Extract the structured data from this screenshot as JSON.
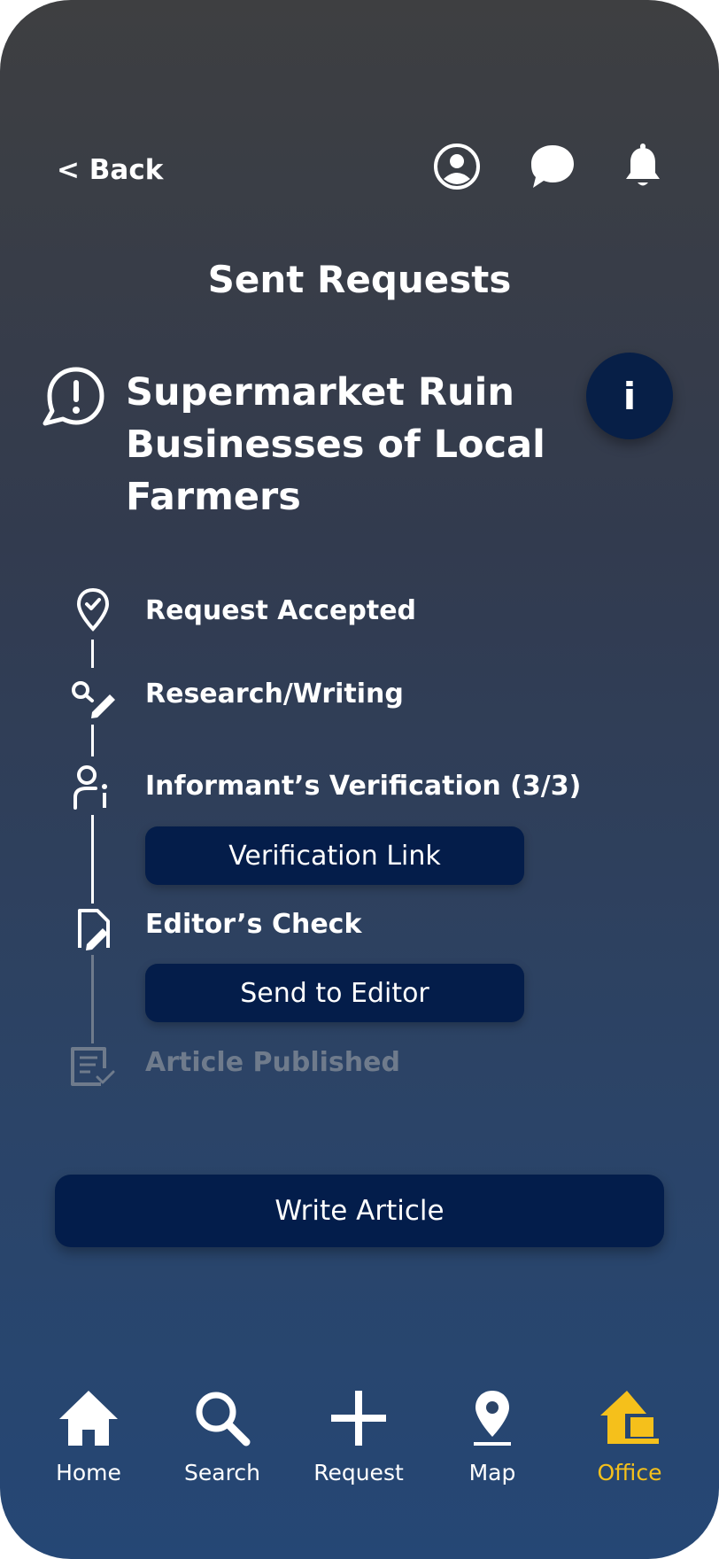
{
  "header": {
    "back_label": "< Back",
    "icons": [
      "profile-icon",
      "chat-icon",
      "bell-icon"
    ]
  },
  "page_title": "Sent Requests",
  "request": {
    "title": "Supermarket Ruin Businesses of Local Farmers",
    "info_label": "i"
  },
  "timeline": {
    "steps": [
      {
        "label": "Request Accepted",
        "icon": "location-check-icon",
        "status": "done"
      },
      {
        "label": "Research/Writing",
        "icon": "search-pen-icon",
        "status": "done"
      },
      {
        "label": "Informant’s Verification (3/3)",
        "icon": "person-info-icon",
        "status": "done",
        "button": "Verification Link"
      },
      {
        "label": "Editor’s Check",
        "icon": "document-edit-icon",
        "status": "current",
        "button": "Send to Editor"
      },
      {
        "label": "Article Published",
        "icon": "document-check-icon",
        "status": "pending"
      }
    ]
  },
  "write_article_label": "Write Article",
  "nav": {
    "items": [
      {
        "label": "Home",
        "icon": "home-icon"
      },
      {
        "label": "Search",
        "icon": "search-icon"
      },
      {
        "label": "Request",
        "icon": "plus-icon"
      },
      {
        "label": "Map",
        "icon": "map-pin-icon"
      },
      {
        "label": "Office",
        "icon": "office-icon"
      }
    ],
    "active": "Office"
  },
  "colors": {
    "accent": "#f5c01b",
    "button": "#041d4a",
    "dimmed": "#6f7b8c",
    "background_top": "#3e3f41",
    "background_bottom": "#254775"
  }
}
